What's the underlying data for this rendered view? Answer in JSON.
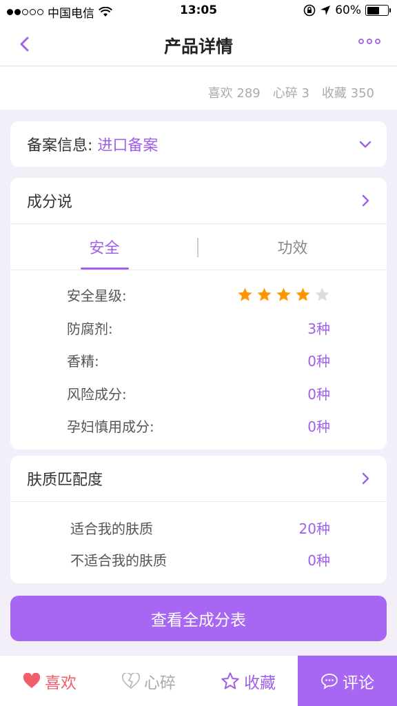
{
  "status": {
    "carrier": "中国电信",
    "time": "13:05",
    "battery": "60%",
    "battery_level": 0.6
  },
  "nav": {
    "title": "产品详情"
  },
  "counts": {
    "like": "喜欢 289",
    "heartbreak": "心碎 3",
    "favorite": "收藏 350"
  },
  "record": {
    "label": "备案信息:",
    "value": "进口备案"
  },
  "ingredients": {
    "title": "成分说",
    "tabs": [
      "安全",
      "功效"
    ],
    "safety_label": "安全星级:",
    "safety_stars": 4,
    "safety_stars_max": 5,
    "rows": [
      {
        "label": "防腐剂:",
        "value": "3种"
      },
      {
        "label": "香精:",
        "value": "0种"
      },
      {
        "label": "风险成分:",
        "value": "0种"
      },
      {
        "label": "孕妇慎用成分:",
        "value": "0种"
      }
    ]
  },
  "skin": {
    "title": "肤质匹配度",
    "rows": [
      {
        "label": "适合我的肤质",
        "value": "20种"
      },
      {
        "label": "不适合我的肤质",
        "value": "0种"
      }
    ]
  },
  "cta": {
    "label": "查看全成分表"
  },
  "tabbar": {
    "like": "喜欢",
    "heartbreak": "心碎",
    "favorite": "收藏",
    "comment": "评论"
  },
  "colors": {
    "accent": "#a060e8",
    "button": "#a767f2",
    "star": "#ff9500",
    "star_empty": "#dddddd",
    "like": "#f0606c"
  }
}
